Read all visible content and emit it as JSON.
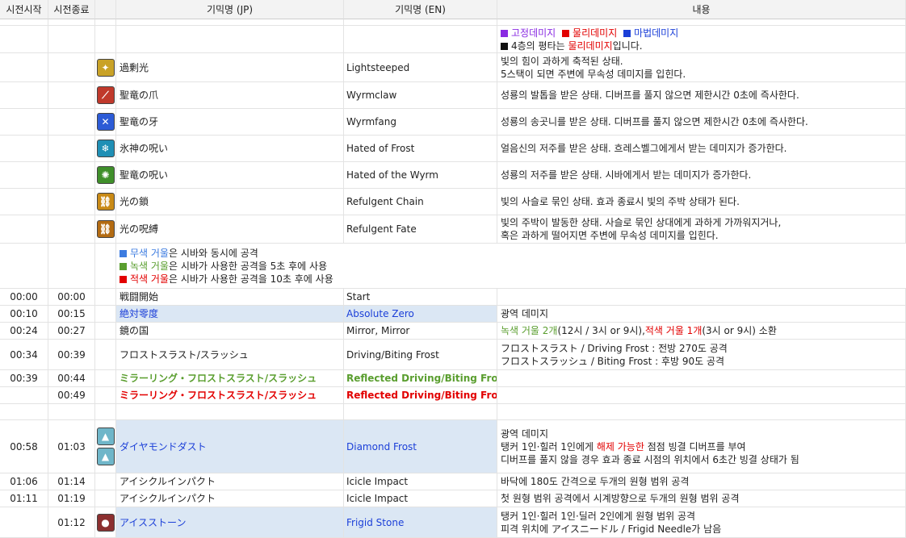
{
  "headers": [
    "시전시작",
    "시전종료",
    "",
    "기믹명 (JP)",
    "기믹명 (EN)",
    "내용"
  ],
  "legend": {
    "items": [
      {
        "label": "고정데미지",
        "color": "#8a2be2"
      },
      {
        "label": "물리데미지",
        "color": "#e20000"
      },
      {
        "label": "마법데미지",
        "color": "#1b3fd8"
      }
    ],
    "note_prefix": "4층의 평타는 ",
    "note_highlight": "물리데미지",
    "note_suffix": "입니다."
  },
  "debuffs": [
    {
      "icon": "lightsteeped-icon",
      "jp": "過剰光",
      "en": "Lightsteeped",
      "desc_1": "빛의 힘이 과하게 축적된 상태.",
      "desc_2": "5스택이 되면 주변에 무속성 데미지를 입힌다.",
      "color": "#c9a227"
    },
    {
      "icon": "wyrmclaw-icon",
      "jp": "聖竜の爪",
      "en": "Wyrmclaw",
      "desc_1": "성룡의 발톱을 받은 상태. 디버프를 풀지 않으면 제한시간 0초에 즉사한다.",
      "desc_2": "",
      "color": "#c0392b"
    },
    {
      "icon": "wyrmfang-icon",
      "jp": "聖竜の牙",
      "en": "Wyrmfang",
      "desc_1": "성룡의 송곳니를 받은 상태. 디버프를 풀지 않으면 제한시간 0초에 즉사한다.",
      "desc_2": "",
      "color": "#2c5bd6"
    },
    {
      "icon": "hated-of-frost-icon",
      "jp": "氷神の呪い",
      "en": "Hated of Frost",
      "desc_1": "얼음신의 저주를 받은 상태. 흐레스벨그에게서 받는 데미지가 증가한다.",
      "desc_2": "",
      "color": "#1f8fb5"
    },
    {
      "icon": "hated-of-the-wyrm-icon",
      "jp": "聖竜の呪い",
      "en": "Hated of the Wyrm",
      "desc_1": "성룡의 저주를 받은 상태. 시바에게서 받는 데미지가 증가한다.",
      "desc_2": "",
      "color": "#3f8f2a"
    },
    {
      "icon": "refulgent-chain-icon",
      "jp": "光の鎖",
      "en": "Refulgent Chain",
      "desc_1": "빛의 사슬로 묶인 상태. 효과 종료시 빛의 주박 상태가 된다.",
      "desc_2": "",
      "color": "#c98a16"
    },
    {
      "icon": "refulgent-fate-icon",
      "jp": "光の呪縛",
      "en": "Refulgent Fate",
      "desc_1": "빛의 주박이 발동한 상태. 사슬로 묶인 상대에게 과하게 가까워지거나,",
      "desc_2": "혹은 과하게 떨어지면 주변에 무속성 데미지를 입힌다.",
      "color": "#b36b12"
    }
  ],
  "mirror_note": {
    "lines": [
      {
        "sq": "#3d7ce0",
        "label": "무색 거울",
        "color": "#3d7ce0",
        "text": "은 시바와 동시에 공격"
      },
      {
        "sq": "#5a9e2f",
        "label": "녹색 거울",
        "color": "#5a9e2f",
        "text": "은 시바가 사용한 공격을 5초 후에 사용"
      },
      {
        "sq": "#e20000",
        "label": "적색 거울",
        "color": "#e20000",
        "text": "은 시바가 사용한 공격을 10초 후에 사용"
      }
    ]
  },
  "timeline": {
    "start": {
      "t1": "00:00",
      "t2": "00:00",
      "jp": "戦闘開始",
      "en": "Start"
    },
    "absolute_zero": {
      "t1": "00:10",
      "t2": "00:15",
      "jp": "絶対零度",
      "en": "Absolute Zero",
      "desc": "광역 데미지"
    },
    "mirror": {
      "t1": "00:24",
      "t2": "00:27",
      "jp": "鏡の国",
      "en": "Mirror, Mirror",
      "d_green": "녹색 거울 2개",
      "d_mid": "(12시 / 3시 or 9시), ",
      "d_red": "적색 거울 1개",
      "d_end": "(3시 or 9시) 소환"
    },
    "frost_thrust": {
      "t1": "00:34",
      "t2": "00:39",
      "jp": "フロストスラスト/スラッシュ",
      "en": "Driving/Biting Frost",
      "desc_1": "フロストスラスト / Driving Frost : 전방 270도 공격",
      "desc_2": "フロストスラッシュ / Biting Frost : 후방 90도 공격"
    },
    "reflect_green": {
      "t1": "00:39",
      "t2": "00:44",
      "jp": "ミラーリング・フロストスラスト/スラッシュ",
      "en": "Reflected Driving/Biting Frost"
    },
    "reflect_red": {
      "t1": "",
      "t2": "00:49",
      "jp": "ミラーリング・フロストスラスト/スラッシュ",
      "en": "Reflected Driving/Biting Frost"
    },
    "diamond": {
      "t1": "00:58",
      "t2": "01:03",
      "jp": "ダイヤモンドダスト",
      "en": "Diamond Frost",
      "desc_1": "광역 데미지",
      "desc_2a": "탱커 1인·힐러 1인에게 ",
      "desc_2b": "해제 가능한",
      "desc_2c": " 점점 빙결 디버프를 부여",
      "desc_3": "디버프를 풀지 않을 경우 효과 종료 시점의 위치에서 6초간 빙결 상태가 됨"
    },
    "icicle_1": {
      "t1": "01:06",
      "t2": "01:14",
      "jp": "アイシクルインパクト",
      "en": "Icicle Impact",
      "desc": "바닥에 180도 간격으로 두개의 원형 범위 공격"
    },
    "icicle_2": {
      "t1": "01:11",
      "t2": "01:19",
      "jp": "アイシクルインパクト",
      "en": "Icicle Impact",
      "desc": "첫 원형 범위 공격에서 시계방향으로 두개의 원형 범위 공격"
    },
    "frigid": {
      "t1": "",
      "t2": "01:12",
      "jp": "アイスストーン",
      "en": "Frigid Stone",
      "desc_1": "탱커 1인·힐러 1인·딜러 2인에게 원형 범위 공격",
      "desc_2": "피격 위치에 アイスニードル / Frigid Needle가 남음"
    }
  },
  "colors": {
    "legend_blue": "#1b3fd8",
    "legend_red": "#e20000",
    "legend_purple": "#8a2be2",
    "highlight_bg": "#dbe7f4",
    "green": "#5a9e2f"
  }
}
